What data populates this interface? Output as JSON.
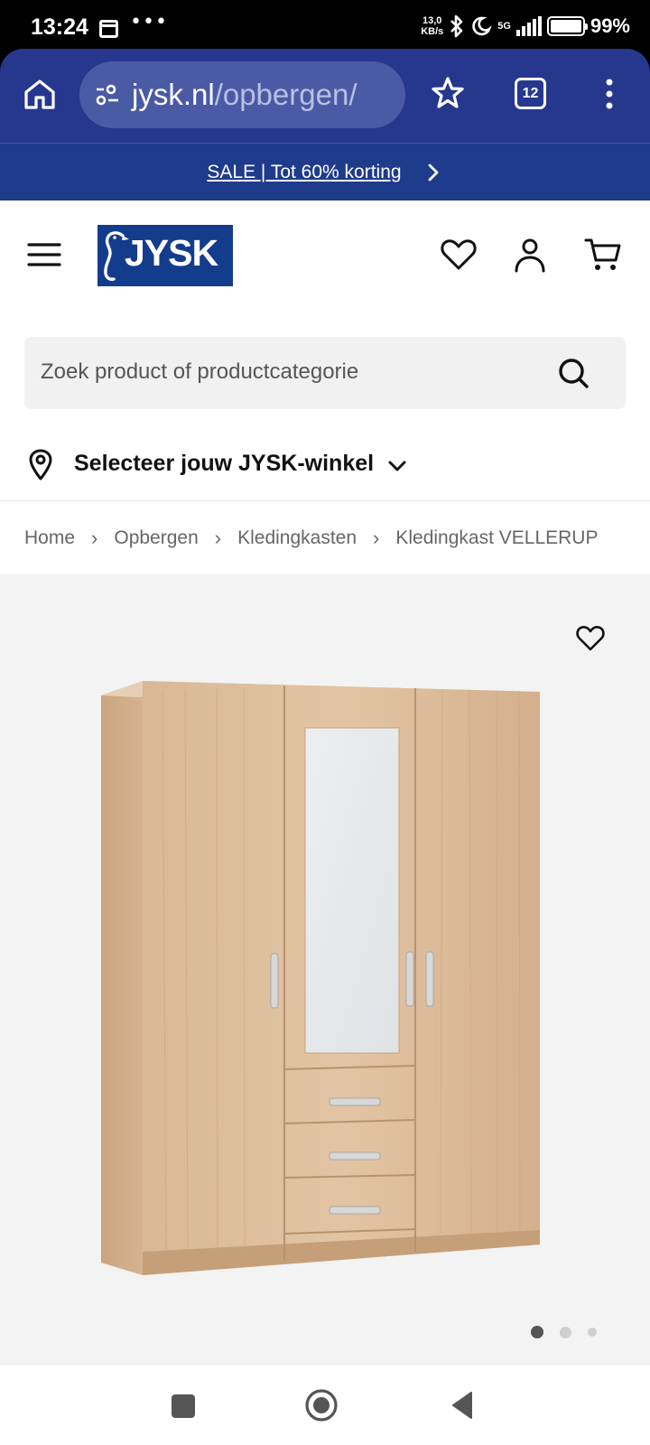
{
  "status_bar": {
    "time": "13:24",
    "net_speed_value": "13,0",
    "net_speed_unit": "KB/s",
    "network_type": "5G",
    "battery_percent": "99%",
    "battery_level": 0.99
  },
  "browser": {
    "url_domain": "jysk.nl",
    "url_path": "/opbergen/",
    "tab_count": "12",
    "toolbar_color": "#26378e"
  },
  "sale_banner": {
    "text": "SALE | Tot 60% korting",
    "color": "#1f3b8c"
  },
  "header": {
    "logo_text": "JYSK",
    "logo_color": "#143c8c",
    "icons": [
      "menu-icon",
      "heart-icon",
      "user-icon",
      "cart-icon"
    ]
  },
  "search": {
    "placeholder": "Zoek product of productcategorie"
  },
  "store": {
    "label": "Selecteer jouw JYSK-winkel"
  },
  "breadcrumb": [
    "Home",
    "Opbergen",
    "Kledingkasten",
    "Kledingkast VELLERUP"
  ],
  "gallery": {
    "slide_count": 3,
    "active_slide": 1
  }
}
